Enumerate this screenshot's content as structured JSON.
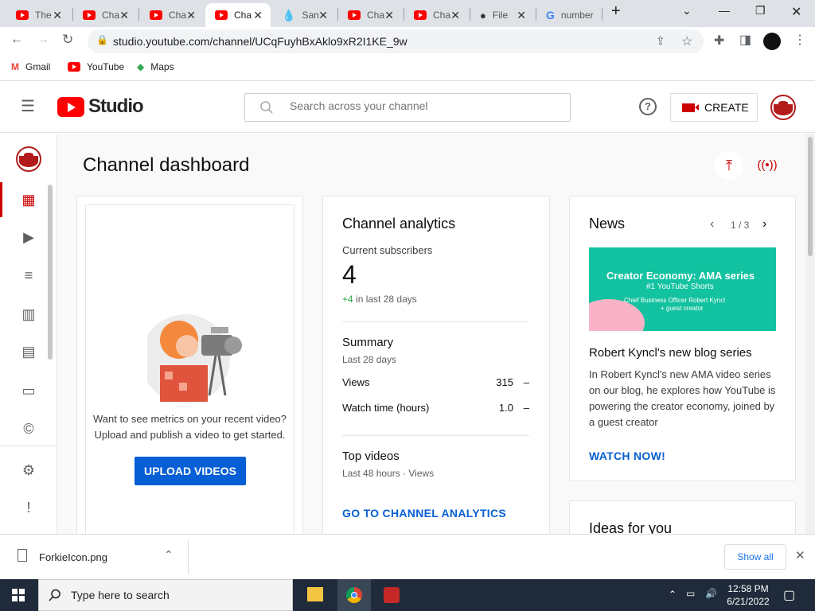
{
  "browser": {
    "tabs": [
      {
        "label": "The",
        "favicon": "youtube-icon"
      },
      {
        "label": "Cha",
        "favicon": "youtube-icon"
      },
      {
        "label": "Cha",
        "favicon": "youtube-icon"
      },
      {
        "label": "Cha",
        "favicon": "youtube-icon",
        "active": true
      },
      {
        "label": "San",
        "favicon": "drop-icon"
      },
      {
        "label": "Cha",
        "favicon": "youtube-icon"
      },
      {
        "label": "Cha",
        "favicon": "youtube-icon"
      },
      {
        "label": "File",
        "favicon": "github-icon"
      },
      {
        "label": "number",
        "favicon": "google-icon"
      }
    ],
    "url": "studio.youtube.com/channel/UCqFuyhBxAklo9xR2I1KE_9w",
    "bookmarks": [
      "Gmail",
      "YouTube",
      "Maps"
    ]
  },
  "studio": {
    "logo_text": "Studio",
    "search_placeholder": "Search across your channel",
    "create_label": "CREATE",
    "page_title": "Channel dashboard"
  },
  "upload_card": {
    "prompt_line1": "Want to see metrics on your recent video?",
    "prompt_line2": "Upload and publish a video to get started.",
    "button_label": "UPLOAD VIDEOS"
  },
  "analytics": {
    "title": "Channel analytics",
    "subscribers_label": "Current subscribers",
    "subscribers_value": "4",
    "subscribers_change": "+4",
    "subscribers_change_suffix": "in last 28 days",
    "summary_title": "Summary",
    "summary_period": "Last 28 days",
    "rows": [
      {
        "label": "Views",
        "value": "315",
        "trend": "–"
      },
      {
        "label": "Watch time (hours)",
        "value": "1.0",
        "trend": "–"
      }
    ],
    "top_videos_title": "Top videos",
    "top_videos_period": "Last 48 hours · Views",
    "link": "GO TO CHANNEL ANALYTICS"
  },
  "news": {
    "title": "News",
    "pager": "1 / 3",
    "image_title": "Creator Economy: AMA series",
    "image_sub": "#1 YouTube Shorts",
    "image_line3": "Chief Business Officer Robert Kyncl",
    "image_line4": "+ guest creator",
    "headline": "Robert Kyncl's new blog series",
    "body": [
      "In Robert Kyncl's new AMA video series",
      "on our blog, he explores how YouTube is",
      "powering the creator economy, joined by",
      "a guest creator"
    ],
    "link": "WATCH NOW!"
  },
  "ideas": {
    "title": "Ideas for you"
  },
  "download": {
    "filename": "ForkieIcon.png",
    "show_all": "Show all"
  },
  "taskbar": {
    "search_placeholder": "Type here to search",
    "time": "12:58 PM",
    "date": "6/21/2022"
  }
}
